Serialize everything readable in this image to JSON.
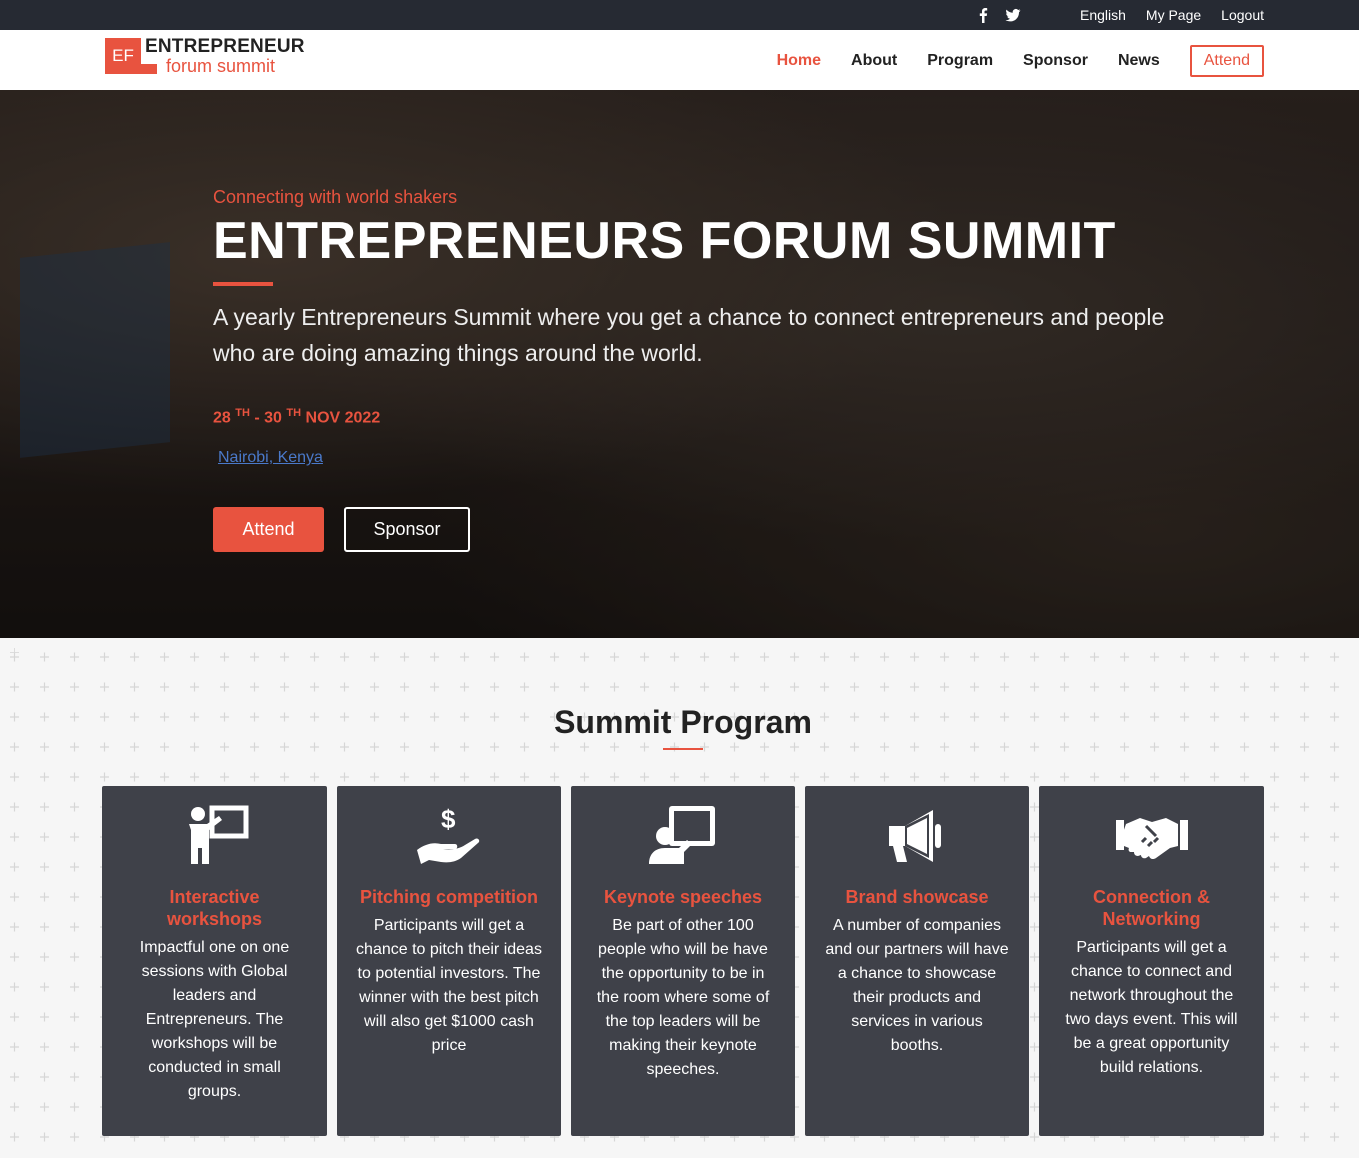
{
  "topbar": {
    "social": [
      "facebook-icon",
      "twitter-icon"
    ],
    "links": [
      "English",
      "My Page",
      "Logout"
    ]
  },
  "logo": {
    "mark": "EF",
    "line1": "ENTREPRENEUR",
    "line2": "forum summit"
  },
  "nav": {
    "items": [
      "Home",
      "About",
      "Program",
      "Sponsor",
      "News"
    ],
    "active": "Home",
    "attend": "Attend"
  },
  "hero": {
    "tag": "Connecting with world shakers",
    "title": "ENTREPRENEURS FORUM SUMMIT",
    "description": "A yearly Entrepreneurs Summit where you get a chance to connect entrepreneurs and people who are doing amazing things around the world.",
    "date_start": "28",
    "date_start_sup": "TH",
    "date_sep": " - 30",
    "date_end_sup": "TH",
    "date_end": "NOV 2022",
    "location": "Nairobi, Kenya",
    "attend_label": "Attend",
    "sponsor_label": "Sponsor"
  },
  "program": {
    "title": "Summit Program",
    "cards": [
      {
        "icon": "presenter-icon",
        "title": "Interactive workshops",
        "text": "Impactful one on one sessions with Global leaders and Entrepreneurs. The workshops will be conducted in small groups."
      },
      {
        "icon": "hand-dollar-icon",
        "title": "Pitching competition",
        "text": "Participants will get a chance to pitch their ideas to potential investors. The winner with the best pitch will also get $1000 cash price"
      },
      {
        "icon": "speaker-board-icon",
        "title": "Keynote speeches",
        "text": "Be part of other 100 people who will be have the opportunity to be in the room where some of the top leaders will be making their keynote speeches."
      },
      {
        "icon": "megaphone-icon",
        "title": "Brand showcase",
        "text": "A number of companies and our partners will have a chance to showcase their products and services in various booths."
      },
      {
        "icon": "handshake-icon",
        "title": "Connection & Networking",
        "text": "Participants will get a chance to connect and network throughout the two days event. This will be a great opportunity build relations."
      }
    ]
  },
  "colors": {
    "accent": "#e8533f",
    "dark": "#262a33",
    "card": "#3f4149"
  }
}
